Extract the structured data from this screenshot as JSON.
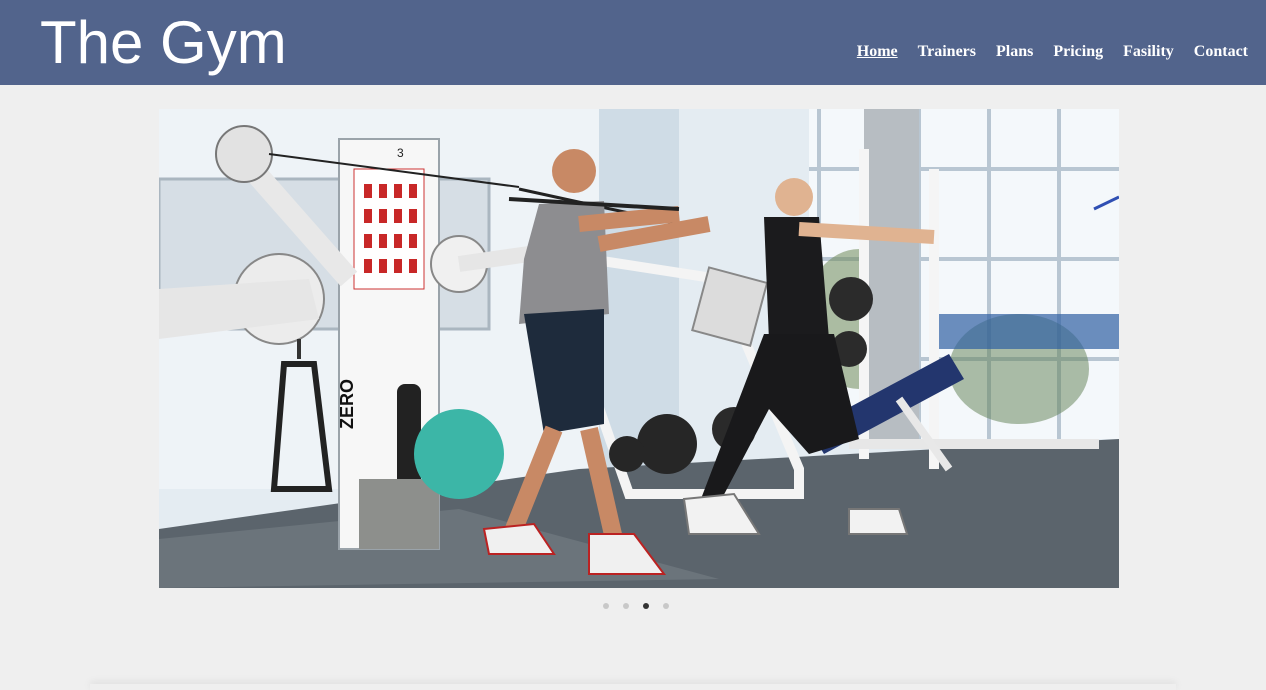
{
  "header": {
    "title": "The Gym",
    "background": "#52648c"
  },
  "nav": {
    "items": [
      {
        "label": "Home",
        "active": true
      },
      {
        "label": "Trainers",
        "active": false
      },
      {
        "label": "Plans",
        "active": false
      },
      {
        "label": "Pricing",
        "active": false
      },
      {
        "label": "Fasility",
        "active": false
      },
      {
        "label": "Contact",
        "active": false
      }
    ]
  },
  "slider": {
    "current_slide": 3,
    "total_slides": 4,
    "machine_number": "3",
    "machine_brand": "ZERO"
  }
}
